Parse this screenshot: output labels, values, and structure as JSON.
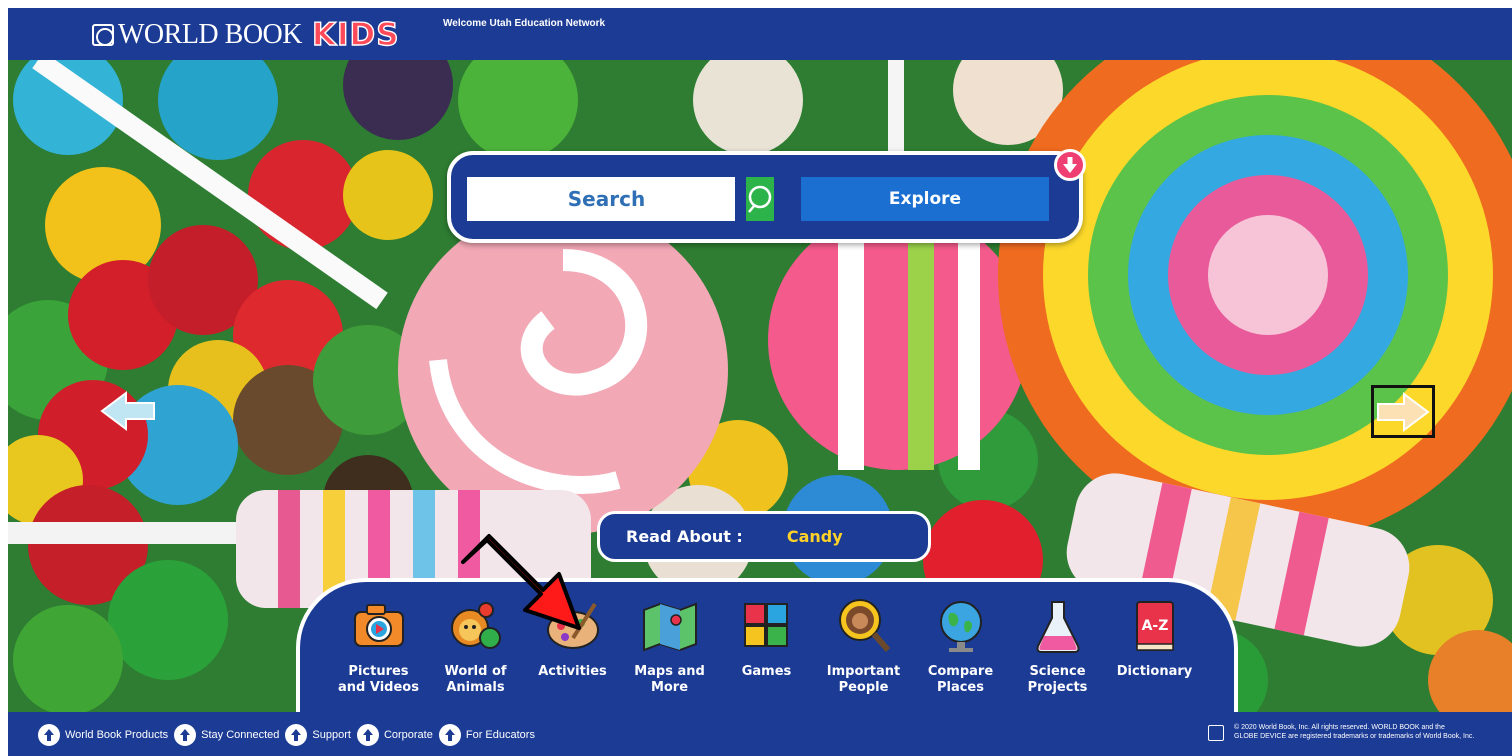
{
  "header": {
    "logo_text": "WORLD BOOK",
    "logo_accent": "KIDS",
    "welcome": "Welcome Utah Education Network"
  },
  "search": {
    "placeholder": "Search",
    "explore_label": "Explore"
  },
  "read_about": {
    "label": "Read About :",
    "value": "Candy"
  },
  "nav": [
    {
      "label": "Pictures\nand Videos",
      "icon": "camera-icon"
    },
    {
      "label": "World of\nAnimals",
      "icon": "animals-icon"
    },
    {
      "label": "Activities",
      "icon": "palette-icon"
    },
    {
      "label": "Maps and\nMore",
      "icon": "map-icon"
    },
    {
      "label": "Games",
      "icon": "puzzle-icon"
    },
    {
      "label": "Important\nPeople",
      "icon": "magnifier-person-icon"
    },
    {
      "label": "Compare\nPlaces",
      "icon": "globe-icon"
    },
    {
      "label": "Science\nProjects",
      "icon": "flask-icon"
    },
    {
      "label": "Dictionary",
      "icon": "book-icon"
    }
  ],
  "footer": {
    "links": [
      "World Book Products",
      "Stay Connected",
      "Support",
      "Corporate",
      "For Educators"
    ],
    "copyright_line1": "© 2020 World Book, Inc. All rights reserved. WORLD BOOK and the",
    "copyright_line2": "GLOBE DEVICE are registered trademarks or trademarks of World Book, Inc."
  },
  "colors": {
    "brand_blue": "#1b3b95",
    "accent_pink": "#ff4a5a",
    "search_green": "#2cb34a",
    "explore_blue": "#1a6fd0",
    "highlight_yellow": "#ffd228",
    "annotation_red": "#ff1a1a"
  }
}
